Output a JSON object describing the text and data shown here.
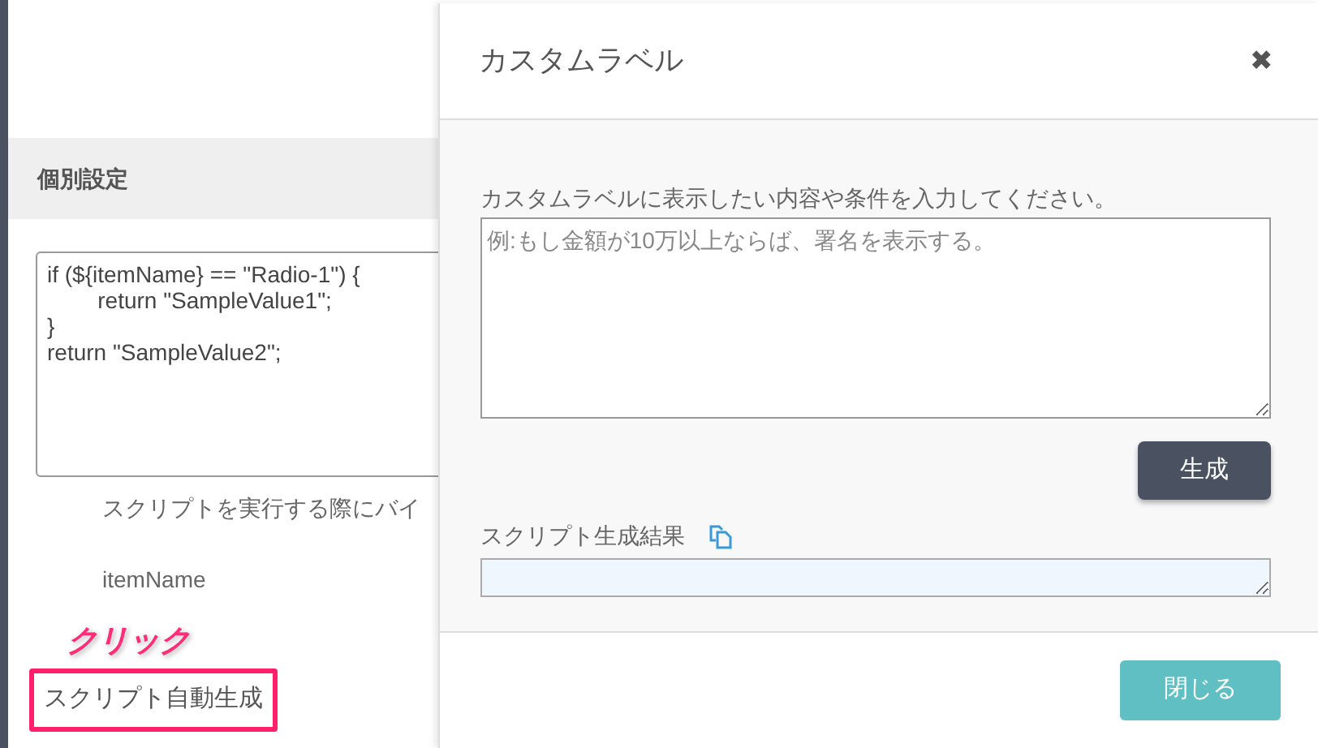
{
  "left_panel": {
    "section_title": "個別設定",
    "script_code": "if (${itemName} == \"Radio-1\") {\n        return \"SampleValue1\";\n}\nreturn \"SampleValue2\";",
    "hint": "スクリプトを実行する際にバイ",
    "variable": "itemName",
    "annotation": "クリック",
    "auto_generate_link": "スクリプト自動生成"
  },
  "dialog": {
    "title": "カスタムラベル",
    "close": "✖",
    "prompt_label": "カスタムラベルに表示したい内容や条件を入力してください。",
    "prompt_placeholder": "例:もし金額が10万以上ならば、署名を表示する。",
    "generate_button": "生成",
    "result_label": "スクリプト生成結果",
    "close_button": "閉じる"
  }
}
